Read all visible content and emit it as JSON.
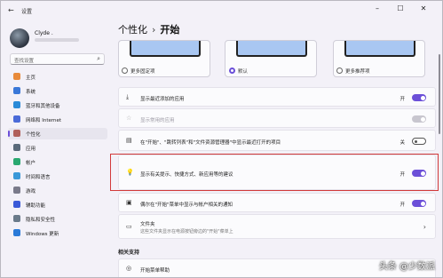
{
  "window": {
    "title": "设置"
  },
  "user": {
    "name": "Clyde ."
  },
  "search": {
    "placeholder": "查找设置"
  },
  "sidebar": {
    "items": [
      {
        "label": "主页",
        "color": "#e88a3a"
      },
      {
        "label": "系统",
        "color": "#3a78d8"
      },
      {
        "label": "蓝牙和其他设备",
        "color": "#2a8ad8"
      },
      {
        "label": "网络和 Internet",
        "color": "#4a6ad8"
      },
      {
        "label": "个性化",
        "color": "#b0605a"
      },
      {
        "label": "应用",
        "color": "#5a6a7a"
      },
      {
        "label": "帐户",
        "color": "#2aa870"
      },
      {
        "label": "时间和语言",
        "color": "#3a98d8"
      },
      {
        "label": "游戏",
        "color": "#7a7a8a"
      },
      {
        "label": "辅助功能",
        "color": "#3a5ad8"
      },
      {
        "label": "隐私和安全性",
        "color": "#6a7a8a"
      },
      {
        "label": "Windows 更新",
        "color": "#2a7ad8"
      }
    ],
    "active_index": 4
  },
  "breadcrumb": {
    "parent": "个性化",
    "separator": "›",
    "current": "开始"
  },
  "layout_options": [
    {
      "label": "更多固定项",
      "selected": false
    },
    {
      "label": "默认",
      "selected": true
    },
    {
      "label": "更多推荐项",
      "selected": false
    }
  ],
  "rows": [
    {
      "label": "显示最近添加的应用",
      "state": "开",
      "toggle": "on",
      "icon": "download-icon"
    },
    {
      "label": "显示常用的应用",
      "state": "",
      "toggle": "disabled",
      "icon": "star-icon"
    },
    {
      "label": "在\"开始\"、\"跳转列表\"和\"文件资源管理器\"中显示最近打开的项目",
      "state": "关",
      "toggle": "off",
      "icon": "recent-files-icon"
    },
    {
      "label": "显示有关提示、快捷方式、新应用等的建议",
      "state": "开",
      "toggle": "on",
      "icon": "lightbulb-icon"
    },
    {
      "label": "偶尔在\"开始\"菜单中显示与帐户相关的通知",
      "state": "开",
      "toggle": "on",
      "icon": "account-icon"
    },
    {
      "label": "文件夹",
      "sub": "这些文件夹显示在电源按钮旁边的\"开始\"菜单上",
      "icon": "folder-icon"
    }
  ],
  "section": {
    "title": "相关支持"
  },
  "support_rows": [
    {
      "label": "开始菜单帮助"
    }
  ],
  "watermark": {
    "text": "头条 @少数派"
  },
  "accent": "#6b4fd8",
  "highlight_color": "#d23a3a"
}
